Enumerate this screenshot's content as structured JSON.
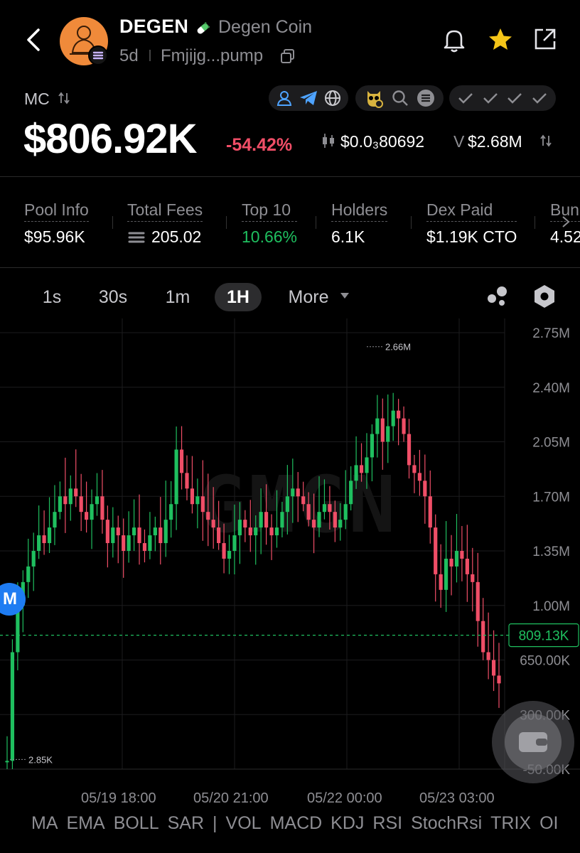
{
  "header": {
    "token_symbol": "DEGEN",
    "token_name": "Degen Coin",
    "age": "5d",
    "address": "Fmjijg...pump"
  },
  "market": {
    "mc_label": "MC",
    "mc_value": "$806.92K",
    "mc_change": "-54.42%",
    "price": "$0.0₃80692",
    "volume_label": "V",
    "volume": "$2.68M"
  },
  "stats": [
    {
      "label": "Pool Info",
      "value": "$95.96K"
    },
    {
      "label": "Total Fees",
      "value": "205.02"
    },
    {
      "label": "Top 10",
      "value": "10.66%"
    },
    {
      "label": "Holders",
      "value": "6.1K"
    },
    {
      "label": "Dex Paid",
      "value": "$1.19K CTO"
    },
    {
      "label": "Bun",
      "value": "4.52"
    }
  ],
  "timeframes": {
    "items": [
      "1s",
      "30s",
      "1m",
      "1H",
      "More"
    ],
    "active": "1H"
  },
  "colors": {
    "up": "#1fbf5f",
    "down": "#f04e67",
    "accent": "#1e7cf2",
    "star": "#f5c518"
  },
  "chart": {
    "watermark": "GMGN",
    "y_ticks": [
      "2.75M",
      "2.40M",
      "2.05M",
      "1.70M",
      "1.35M",
      "1.00M",
      "650.00K",
      "300.00K",
      "-50.00K"
    ],
    "current_price_label": "809.13K",
    "max_label": "2.66M",
    "min_label": "2.85K",
    "marker_label": "M",
    "x_ticks": [
      "05/19 18:00",
      "05/20 21:00",
      "05/22 00:00",
      "05/23 03:00"
    ]
  },
  "chart_data": {
    "type": "candlestick",
    "ylim": [
      -50000,
      2750000
    ],
    "current": 809130,
    "high_marker": 2660000,
    "low_marker": 2850,
    "closes": [
      2850,
      700000,
      1000000,
      1150000,
      1250000,
      1350000,
      1450000,
      1400000,
      1500000,
      1600000,
      1700000,
      1650000,
      1750000,
      1700000,
      1600000,
      1550000,
      1650000,
      1700000,
      1550000,
      1400000,
      1500000,
      1450000,
      1350000,
      1450000,
      1500000,
      1400000,
      1350000,
      1450000,
      1500000,
      1400000,
      1550000,
      1650000,
      2000000,
      1850000,
      1750000,
      1650000,
      1700000,
      1600000,
      1550000,
      1500000,
      1400000,
      1300000,
      1350000,
      1450000,
      1550000,
      1500000,
      1450000,
      1500000,
      1600000,
      1500000,
      1450000,
      1500000,
      1600000,
      1700000,
      1750000,
      1700000,
      1650000,
      1550000,
      1500000,
      1600000,
      1650000,
      1600000,
      1500000,
      1550000,
      1650000,
      1800000,
      1900000,
      1850000,
      1950000,
      2100000,
      2200000,
      2050000,
      2150000,
      2250000,
      2200000,
      2100000,
      1900000,
      1850000,
      1800000,
      1700000,
      1500000,
      1200000,
      1100000,
      1300000,
      1250000,
      1350000,
      1300000,
      1200000,
      1150000,
      900000,
      700000,
      650000,
      550000,
      500000
    ]
  },
  "indicators": [
    "MA",
    "EMA",
    "BOLL",
    "SAR",
    "|",
    "VOL",
    "MACD",
    "KDJ",
    "RSI",
    "StochRsi",
    "TRIX",
    "OI"
  ]
}
